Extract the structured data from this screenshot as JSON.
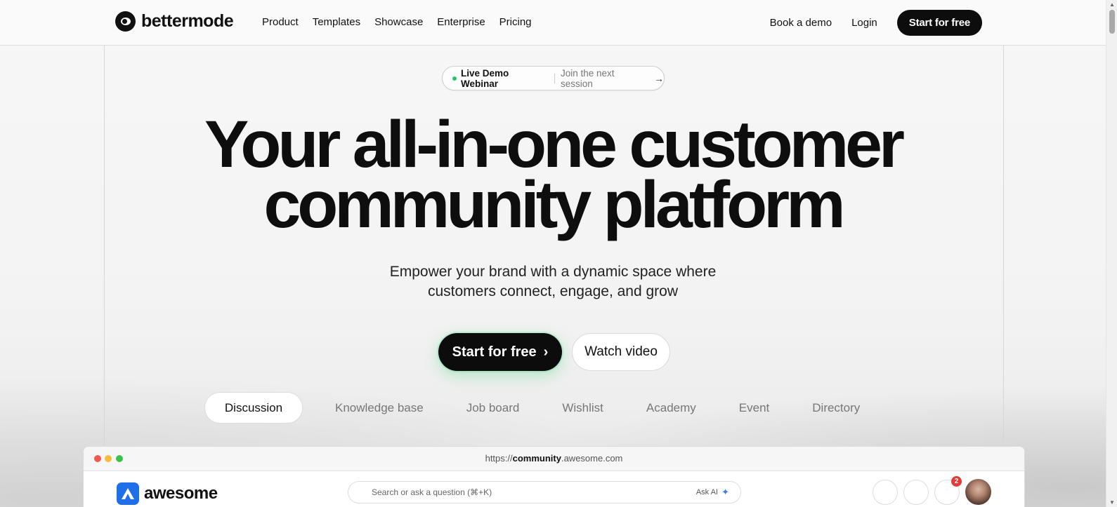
{
  "header": {
    "logo_text": "bettermode",
    "nav": [
      "Product",
      "Templates",
      "Showcase",
      "Enterprise",
      "Pricing"
    ],
    "book_demo": "Book a demo",
    "login": "Login",
    "start_free": "Start for free"
  },
  "announcement": {
    "strong": "Live Demo Webinar",
    "light": "Join the next session",
    "arrow": "→"
  },
  "hero": {
    "title_line1": "Your all-in-one customer",
    "title_line2": "community platform",
    "subtitle_line1": "Empower your brand with a dynamic space where",
    "subtitle_line2": "customers connect, engage, and grow",
    "cta_primary": "Start for free",
    "cta_primary_icon": "›",
    "cta_secondary": "Watch video"
  },
  "tabs": [
    "Discussion",
    "Knowledge base",
    "Job board",
    "Wishlist",
    "Academy",
    "Event",
    "Directory"
  ],
  "active_tab": "Discussion",
  "browser_mock": {
    "url_prefix": "https://",
    "url_bold": "community",
    "url_suffix": ".awesome.com",
    "app_logo": "awesome",
    "search_placeholder": "Search or ask a question (⌘+K)",
    "ask_ai": "Ask AI",
    "notification_count": "2"
  },
  "colors": {
    "primary_dark": "#0c0c0c",
    "accent_green": "#2bc26b",
    "app_blue": "#1f6fe8",
    "badge_red": "#e43a3a"
  }
}
